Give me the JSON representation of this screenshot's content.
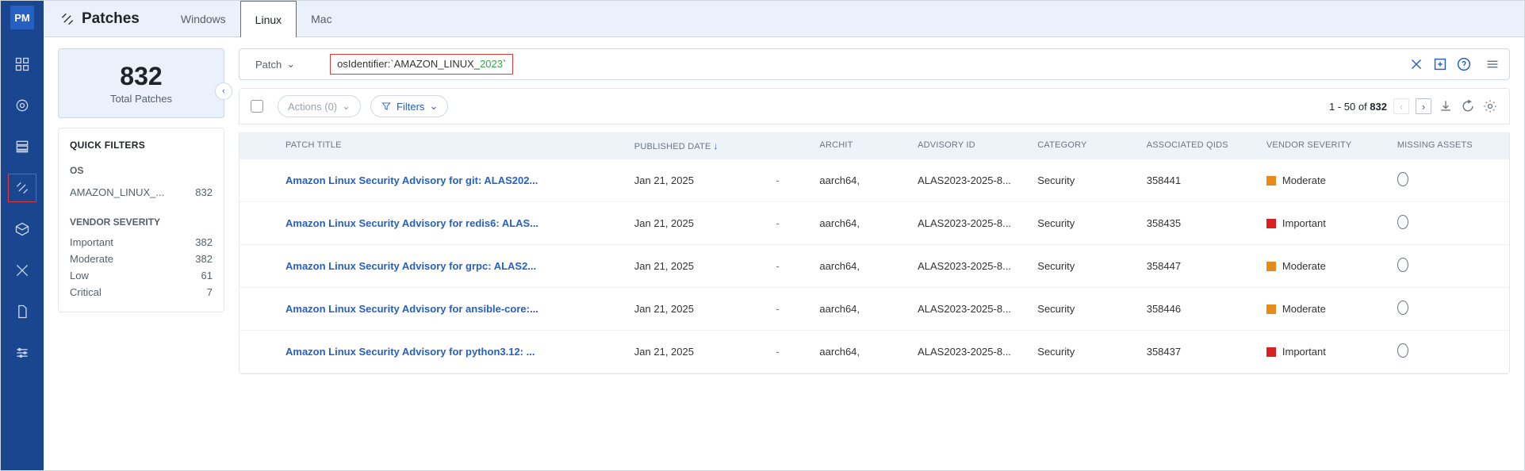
{
  "logo": "PM",
  "page_title": "Patches",
  "tabs": [
    "Windows",
    "Linux",
    "Mac"
  ],
  "active_tab": "Linux",
  "total_card": {
    "value": "832",
    "label": "Total Patches"
  },
  "quick_filters": {
    "heading": "QUICK FILTERS",
    "sections": [
      {
        "title": "OS",
        "rows": [
          {
            "label": "AMAZON_LINUX_...",
            "count": "832"
          }
        ]
      },
      {
        "title": "VENDOR SEVERITY",
        "rows": [
          {
            "label": "Important",
            "count": "382"
          },
          {
            "label": "Moderate",
            "count": "382"
          },
          {
            "label": "Low",
            "count": "61"
          },
          {
            "label": "Critical",
            "count": "7"
          }
        ]
      }
    ]
  },
  "search": {
    "dropdown": "Patch",
    "query_prefix": "osIdentifier:`AMAZON_LINUX_",
    "query_green": "2023",
    "query_suffix": "`"
  },
  "toolbar": {
    "actions": "Actions (0)",
    "filters": "Filters",
    "paging_prefix": "1 - 50 of ",
    "paging_total": "832"
  },
  "columns": [
    "PATCH TITLE",
    "PUBLISHED DATE",
    "",
    "ARCHIT",
    "ADVISORY ID",
    "CATEGORY",
    "ASSOCIATED QIDS",
    "VENDOR SEVERITY",
    "MISSING ASSETS"
  ],
  "rows": [
    {
      "title": "Amazon Linux Security Advisory for git: ALAS202...",
      "date": "Jan 21, 2025",
      "dash": "-",
      "arch": "aarch64,",
      "adv": "ALAS2023-2025-8...",
      "cat": "Security",
      "qid": "358441",
      "sev": "Moderate",
      "sev_class": "mod"
    },
    {
      "title": "Amazon Linux Security Advisory for redis6: ALAS...",
      "date": "Jan 21, 2025",
      "dash": "-",
      "arch": "aarch64,",
      "adv": "ALAS2023-2025-8...",
      "cat": "Security",
      "qid": "358435",
      "sev": "Important",
      "sev_class": "imp"
    },
    {
      "title": "Amazon Linux Security Advisory for grpc: ALAS2...",
      "date": "Jan 21, 2025",
      "dash": "-",
      "arch": "aarch64,",
      "adv": "ALAS2023-2025-8...",
      "cat": "Security",
      "qid": "358447",
      "sev": "Moderate",
      "sev_class": "mod"
    },
    {
      "title": "Amazon Linux Security Advisory for ansible-core:...",
      "date": "Jan 21, 2025",
      "dash": "-",
      "arch": "aarch64,",
      "adv": "ALAS2023-2025-8...",
      "cat": "Security",
      "qid": "358446",
      "sev": "Moderate",
      "sev_class": "mod"
    },
    {
      "title": "Amazon Linux Security Advisory for python3.12: ...",
      "date": "Jan 21, 2025",
      "dash": "-",
      "arch": "aarch64,",
      "adv": "ALAS2023-2025-8...",
      "cat": "Security",
      "qid": "358437",
      "sev": "Important",
      "sev_class": "imp"
    }
  ]
}
